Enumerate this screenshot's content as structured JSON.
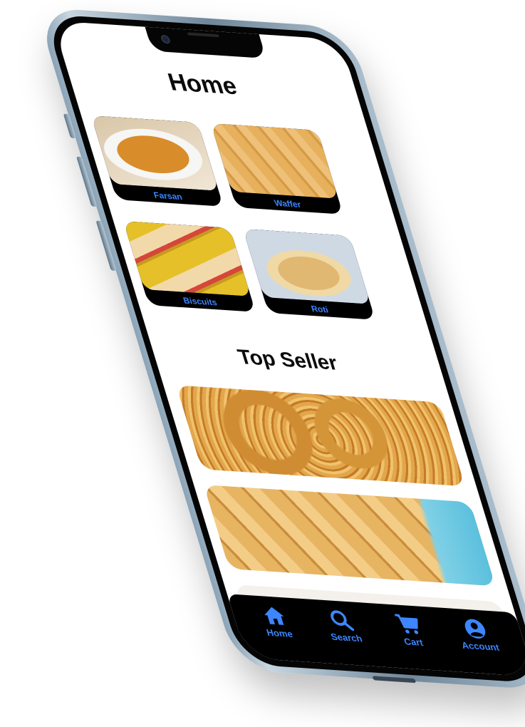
{
  "header": {
    "title": "Home"
  },
  "categories": [
    {
      "label": "Farsan",
      "icon": "farsan-image"
    },
    {
      "label": "Waffer",
      "icon": "waffer-image"
    },
    {
      "label": "Biscuits",
      "icon": "biscuits-image"
    },
    {
      "label": "Roti",
      "icon": "roti-image"
    }
  ],
  "top_seller": {
    "title": "Top Seller"
  },
  "bottom_nav": [
    {
      "label": "Home",
      "icon": "home-icon"
    },
    {
      "label": "Search",
      "icon": "search-icon"
    },
    {
      "label": "Cart",
      "icon": "cart-icon"
    },
    {
      "label": "Account",
      "icon": "account-icon"
    }
  ],
  "colors": {
    "accent": "#3d86ff",
    "nav_background": "#000000",
    "screen_background": "#ffffff"
  }
}
